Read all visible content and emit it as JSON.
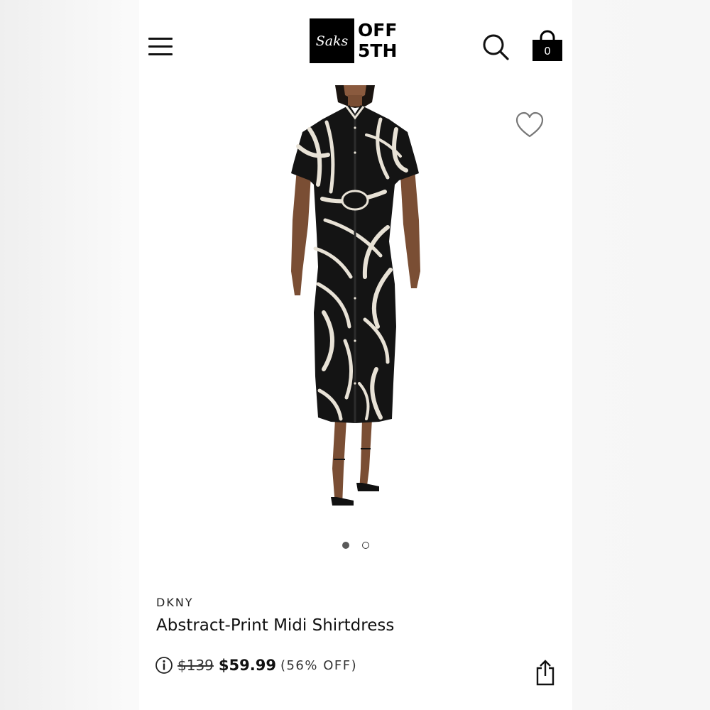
{
  "header": {
    "logo_script": "Saks",
    "logo_line1": "OFF",
    "logo_line2": "5TH",
    "bag_count": "0",
    "menu_icon": "hamburger-menu-icon",
    "search_icon": "search-icon",
    "bag_icon": "shopping-bag-icon"
  },
  "gallery": {
    "image_count": 2,
    "active_index": 0,
    "favorite_icon": "heart-icon"
  },
  "product": {
    "brand": "DKNY",
    "name": "Abstract-Print Midi Shirtdress",
    "price_original": "$139",
    "price_sale": "$59.99",
    "discount": "(56% OFF)",
    "info_icon": "info-icon",
    "share_icon": "share-icon"
  },
  "colors": {
    "text": "#111111",
    "background": "#ffffff",
    "dress_black": "#141414",
    "dress_print": "#e8e2d6"
  }
}
